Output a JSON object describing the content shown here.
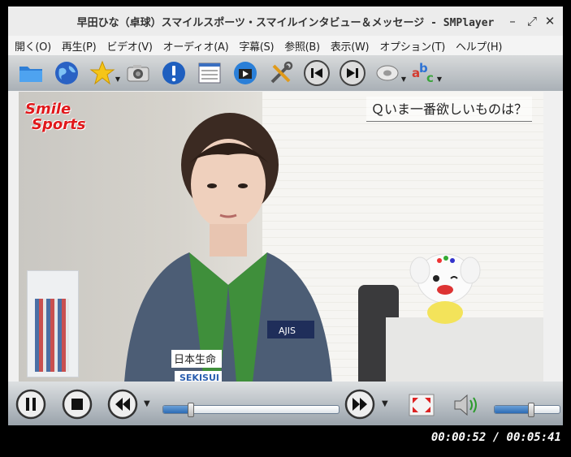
{
  "window": {
    "title": "早田ひな（卓球）スマイルスポーツ・スマイルインタビュー＆メッセージ - SMPlayer",
    "minimize_glyph": "–",
    "maximize_glyph": "⤢",
    "close_glyph": "✕"
  },
  "menu": [
    "開く(O)",
    "再生(P)",
    "ビデオ(V)",
    "オーディオ(A)",
    "字幕(S)",
    "参照(B)",
    "表示(W)",
    "オプション(T)",
    "ヘルプ(H)"
  ],
  "toolbar": {
    "icons": [
      "folder-icon",
      "globe-icon",
      "star-favorites-icon",
      "camera-icon",
      "info-exclamation-icon",
      "playlist-icon",
      "clapperboard-icon",
      "tools-icon",
      "previous-track-icon",
      "next-track-icon",
      "audio-disc-icon",
      "subtitles-abc-icon"
    ]
  },
  "video": {
    "logo_line1": "Smile",
    "logo_line2": "Sports",
    "caption": "Ｑいま一番欲しいものは？",
    "jacket_text_1": "日本生命",
    "jacket_text_2": "AJIS",
    "jacket_text_3": "SEKISUI"
  },
  "controls": {
    "icons": [
      "pause-icon",
      "stop-icon",
      "rewind-icon",
      "forward-icon",
      "fullscreen-icon",
      "volume-icon"
    ],
    "seek_progress": 0.152,
    "volume_level": 0.55
  },
  "status": {
    "time": "00:00:52 / 00:05:41"
  },
  "colors": {
    "logo_red": "#e0181b",
    "accent_blue": "#2b6bb5"
  }
}
